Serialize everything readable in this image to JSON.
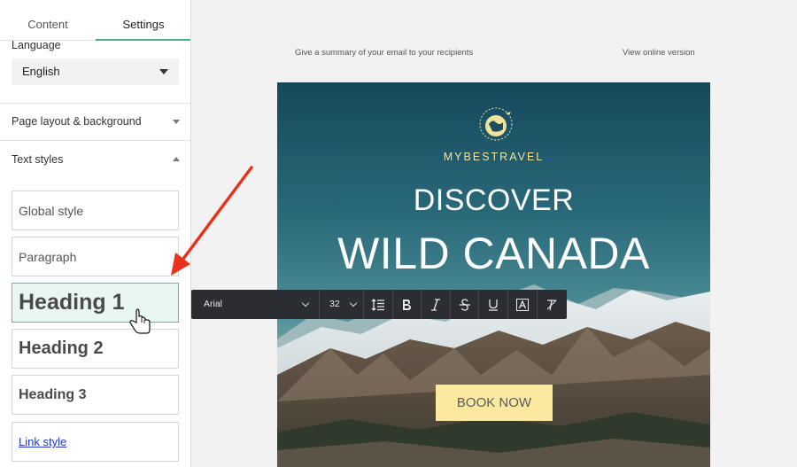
{
  "tabs": [
    {
      "label": "Content"
    },
    {
      "label": "Settings"
    }
  ],
  "settings": {
    "language_label": "Language",
    "language_value": "English",
    "page_layout_label": "Page layout & background",
    "text_styles_label": "Text styles",
    "styles": [
      {
        "label": "Global style"
      },
      {
        "label": "Paragraph"
      },
      {
        "label": "Heading 1"
      },
      {
        "label": "Heading 2"
      },
      {
        "label": "Heading 3"
      },
      {
        "label": "Link style"
      }
    ]
  },
  "email": {
    "preheader": "Give a summary of your email to your recipients",
    "online_version": "View online version",
    "brand": "MYBESTRAVEL",
    "headline_small": "DISCOVER",
    "headline_large": "WILD CANADA",
    "cta": "BOOK NOW"
  },
  "toolbar": {
    "font": "Arial",
    "size": "32",
    "icons": [
      "line-height-icon",
      "bold-icon",
      "italic-icon",
      "strikethrough-icon",
      "underline-icon",
      "text-color-icon",
      "clear-format-icon"
    ]
  },
  "colors": {
    "accent": "#5fbf99",
    "brand_text": "#f0e39a",
    "cta_bg": "#fbe9a0",
    "toolbar_bg": "#2c2c33",
    "arrow": "#e8331c"
  }
}
